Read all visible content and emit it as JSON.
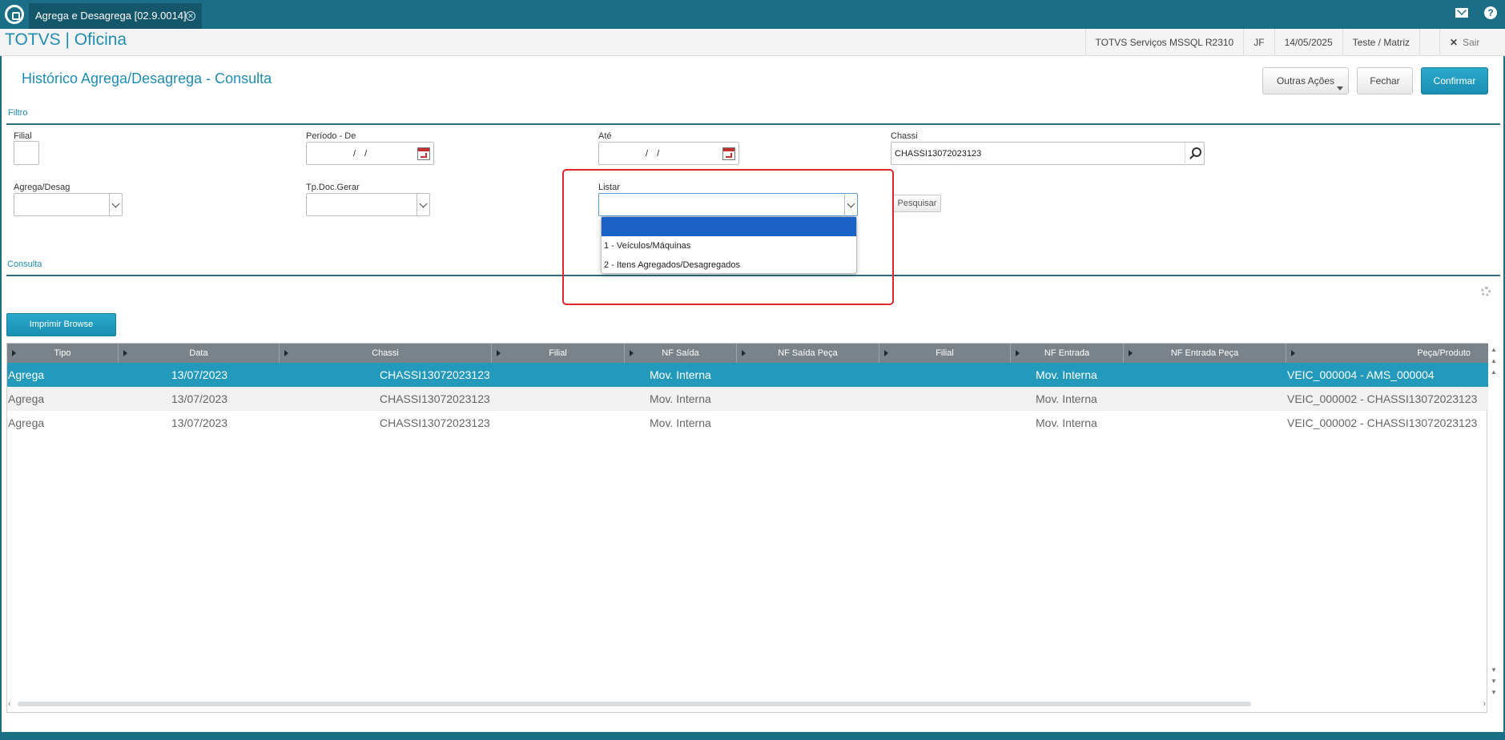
{
  "app": {
    "tab_title": "Agrega e Desagrega [02.9.0014]",
    "brand": "TOTVS | Oficina"
  },
  "header": {
    "server": "TOTVS Serviços MSSQL R2310",
    "user": "JF",
    "date": "14/05/2025",
    "company": "Teste / Matriz",
    "exit_label": "Sair"
  },
  "page": {
    "title": "Histórico Agrega/Desagrega - Consulta",
    "actions": {
      "outras": "Outras Ações",
      "fechar": "Fechar",
      "confirmar": "Confirmar"
    }
  },
  "filtro": {
    "section_label": "Filtro",
    "filial_label": "Filial",
    "filial_value": "",
    "periodo_de_label": "Período - De",
    "periodo_de_value": "/ /",
    "ate_label": "Até",
    "ate_value": "/ /",
    "chassi_label": "Chassi",
    "chassi_value": "CHASSI13072023123",
    "agrega_label": "Agrega/Desag",
    "tpdoc_label": "Tp.Doc.Gerar",
    "listar_label": "Listar",
    "pesquisar": "Pesquisar",
    "listar_options": [
      "",
      "1 - Veículos/Máquinas",
      "2 - Itens Agregados/Desagregados"
    ]
  },
  "consulta": {
    "section_label": "Consulta",
    "print_button": "Imprimir Browse",
    "columns": [
      "Tipo",
      "Data",
      "Chassi",
      "Filial",
      "NF Saída",
      "NF Saída Peça",
      "Filial",
      "NF Entrada",
      "NF Entrada Peça",
      "Peça/Produto"
    ],
    "rows": [
      [
        "Agrega",
        "13/07/2023",
        "CHASSI13072023123",
        "",
        "Mov. Interna",
        "",
        "",
        "Mov. Interna",
        "",
        "VEIC_000004 - AMS_000004"
      ],
      [
        "Agrega",
        "13/07/2023",
        "CHASSI13072023123",
        "",
        "Mov. Interna",
        "",
        "",
        "Mov. Interna",
        "",
        "VEIC_000002 - CHASSI13072023123"
      ],
      [
        "Agrega",
        "13/07/2023",
        "CHASSI13072023123",
        "",
        "Mov. Interna",
        "",
        "",
        "Mov. Interna",
        "",
        "VEIC_000002 - CHASSI13072023123"
      ]
    ]
  },
  "colors": {
    "primary": "#1a6f87",
    "accent": "#2399bb",
    "highlight": "#e0242b",
    "dropdown_selected": "#1a62c6"
  }
}
